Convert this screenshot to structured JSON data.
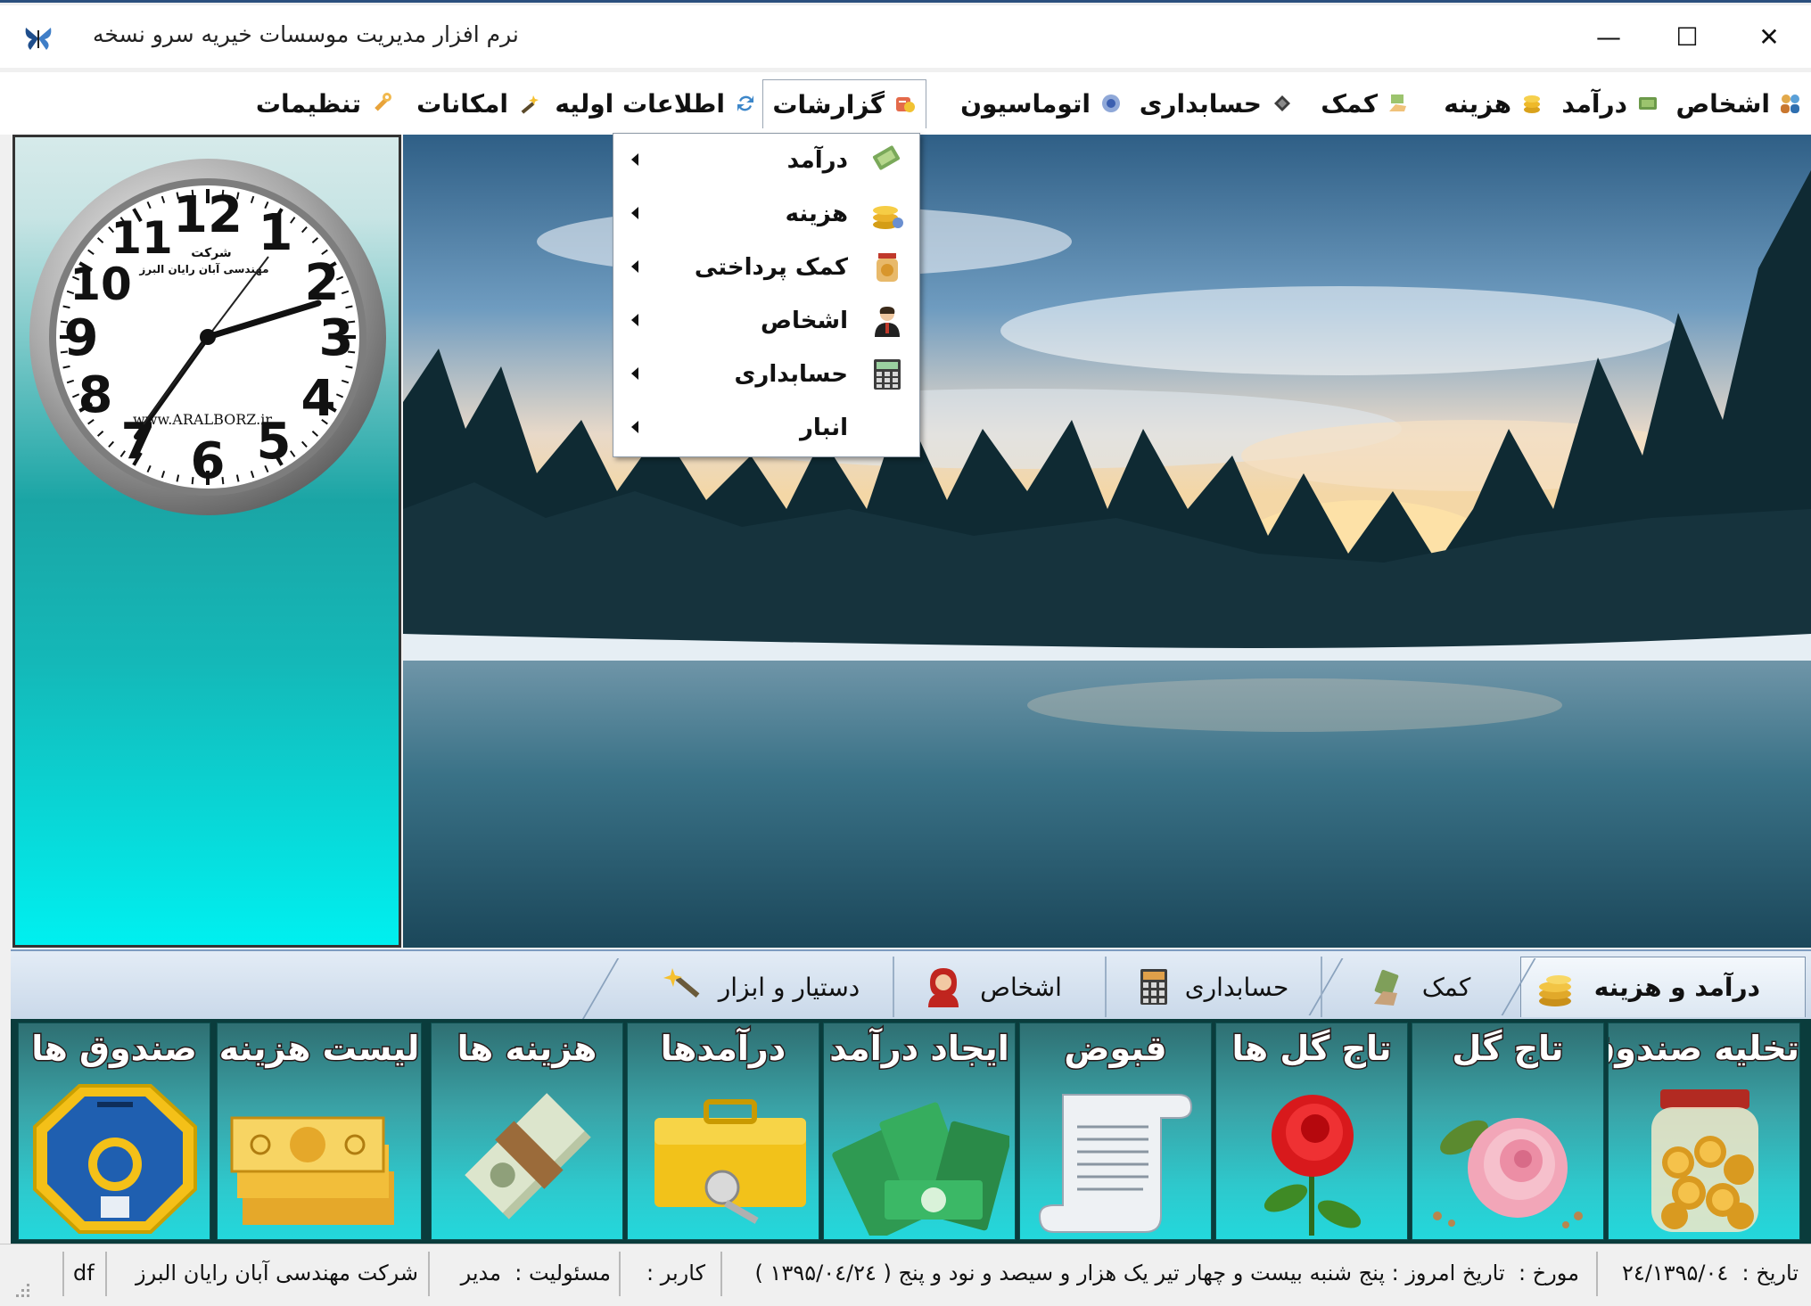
{
  "window": {
    "title": "نرم افزار مدیریت موسسات خیریه سرو نسخه",
    "minimize_glyph": "—",
    "maximize_glyph": "☐",
    "close_glyph": "✕"
  },
  "menu": {
    "items": [
      {
        "label": "اشخاص",
        "icon": "people-icon"
      },
      {
        "label": "درآمد",
        "icon": "money-icon"
      },
      {
        "label": "هزینه",
        "icon": "coins-icon"
      },
      {
        "label": "کمک",
        "icon": "hand-money-icon"
      },
      {
        "label": "حسابداری",
        "icon": "ledger-icon"
      },
      {
        "label": "اتوماسیون",
        "icon": "gear-circle-icon"
      },
      {
        "label": "گزارشات",
        "icon": "report-icon"
      },
      {
        "label": "اطلاعات اولیه",
        "icon": "refresh-icon"
      },
      {
        "label": "امکانات",
        "icon": "wand-icon"
      },
      {
        "label": "تنظیمات",
        "icon": "wrench-icon"
      }
    ]
  },
  "reports_dropdown": {
    "items": [
      {
        "label": "درآمد",
        "icon": "money-icon"
      },
      {
        "label": "هزینه",
        "icon": "coins-icon"
      },
      {
        "label": "کمک پرداختی",
        "icon": "jar-icon"
      },
      {
        "label": "اشخاص",
        "icon": "person-icon"
      },
      {
        "label": "حسابداری",
        "icon": "calculator-icon"
      },
      {
        "label": "انبار",
        "icon": ""
      }
    ]
  },
  "clock": {
    "numbers": [
      "12",
      "1",
      "2",
      "3",
      "4",
      "5",
      "6",
      "7",
      "8",
      "9",
      "10",
      "11"
    ],
    "company_line1": "شرکت",
    "company_line2": "مهندسی آبان رایان البرز",
    "website": "www.ARALBORZ.ir"
  },
  "tabs": [
    {
      "label": "درآمد و هزینه",
      "icon": "coins-icon",
      "selected": true
    },
    {
      "label": "کمک",
      "icon": "hand-money-icon",
      "selected": false
    },
    {
      "label": "حسابداری",
      "icon": "calculator-icon",
      "selected": false
    },
    {
      "label": "اشخاص",
      "icon": "woman-icon",
      "selected": false
    },
    {
      "label": "دستیار و ابزار",
      "icon": "wand-icon",
      "selected": false
    }
  ],
  "tiles": [
    {
      "label": "تخلیه صندوق",
      "icon": "coin-jar-icon"
    },
    {
      "label": "تاج گل",
      "icon": "pink-rose-icon"
    },
    {
      "label": "تاج گل ها",
      "icon": "red-rose-icon"
    },
    {
      "label": "قبوض",
      "icon": "scroll-icon"
    },
    {
      "label": "ایجاد درآمد",
      "icon": "cash-stack-icon"
    },
    {
      "label": "درآمدها",
      "icon": "cashbox-icon"
    },
    {
      "label": "هزینه ها",
      "icon": "money-bundle-icon"
    },
    {
      "label": "لیست هزینه",
      "icon": "banknotes-icon"
    },
    {
      "label": "صندوق ها",
      "icon": "charity-box-icon"
    }
  ],
  "status": {
    "date_label": "تاریخ :",
    "date_value": "۱۳۹۵/۰٤/۲٤",
    "dated_label": "مورخ :",
    "dated_value": "تاریخ امروز : پنج شنبه بیست و چهار تیر یک هزار و سیصد و نود و پنج ( ۱۳۹۵/۰٤/۲٤ )",
    "user_label": "کاربر :",
    "role_label": "مسئولیت :",
    "role_value": "مدیر",
    "company": "شرکت مهندسی آبان رایان البرز",
    "extra": "df"
  }
}
